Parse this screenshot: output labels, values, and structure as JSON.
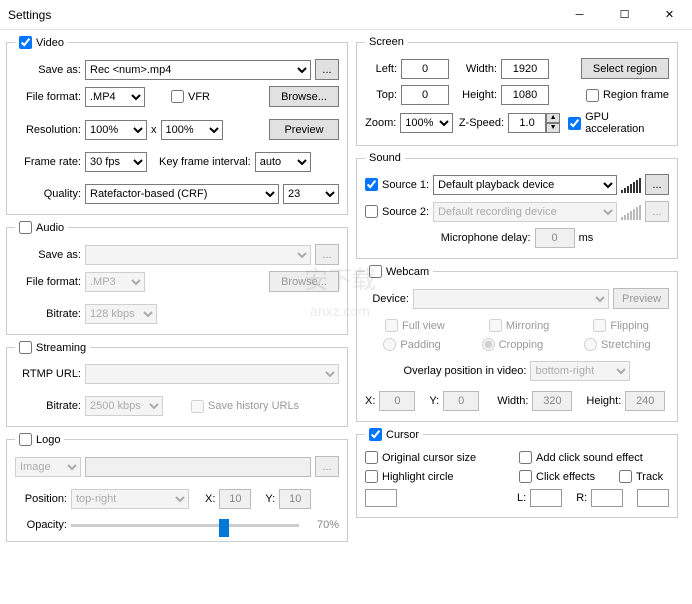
{
  "window": {
    "title": "Settings"
  },
  "video": {
    "legend": "Video",
    "save_as_lbl": "Save as:",
    "save_as": "Rec <num>.mp4",
    "file_format_lbl": "File format:",
    "file_format": ".MP4",
    "vfr_lbl": "VFR",
    "browse": "Browse...",
    "resolution_lbl": "Resolution:",
    "res_w": "100%",
    "res_h": "100%",
    "x": "x",
    "preview": "Preview",
    "frame_rate_lbl": "Frame rate:",
    "frame_rate": "30 fps",
    "kfi_lbl": "Key frame interval:",
    "kfi": "auto",
    "quality_lbl": "Quality:",
    "quality": "Ratefactor-based (CRF)",
    "crf": "23",
    "ellipsis": "..."
  },
  "audio": {
    "legend": "Audio",
    "save_as_lbl": "Save as:",
    "save_as": "",
    "file_format_lbl": "File format:",
    "file_format": ".MP3",
    "browse": "Browse...",
    "bitrate_lbl": "Bitrate:",
    "bitrate": "128 kbps",
    "ellipsis": "..."
  },
  "streaming": {
    "legend": "Streaming",
    "url_lbl": "RTMP URL:",
    "url": "",
    "bitrate_lbl": "Bitrate:",
    "bitrate": "2500 kbps",
    "save_hist": "Save history URLs"
  },
  "logo": {
    "legend": "Logo",
    "type": "Image",
    "position_lbl": "Position:",
    "position": "top-right",
    "x_lbl": "X:",
    "x": "10",
    "y_lbl": "Y:",
    "y": "10",
    "opacity_lbl": "Opacity:",
    "opacity_val": "70%",
    "ellipsis": "..."
  },
  "screen": {
    "legend": "Screen",
    "left_lbl": "Left:",
    "left": "0",
    "width_lbl": "Width:",
    "width": "1920",
    "select_region": "Select region",
    "top_lbl": "Top:",
    "top": "0",
    "height_lbl": "Height:",
    "height": "1080",
    "region_frame": "Region frame",
    "zoom_lbl": "Zoom:",
    "zoom": "100%",
    "zspeed_lbl": "Z-Speed:",
    "zspeed": "1.0",
    "gpu": "GPU acceleration"
  },
  "sound": {
    "legend": "Sound",
    "src1_lbl": "Source 1:",
    "src1": "Default playback device",
    "src2_lbl": "Source 2:",
    "src2": "Default recording device",
    "mic_delay_lbl": "Microphone delay:",
    "mic_delay": "0",
    "ms": "ms",
    "ellipsis": "..."
  },
  "webcam": {
    "legend": "Webcam",
    "device_lbl": "Device:",
    "preview": "Preview",
    "full_view": "Full view",
    "mirroring": "Mirroring",
    "flipping": "Flipping",
    "padding": "Padding",
    "cropping": "Cropping",
    "stretching": "Stretching",
    "overlay_lbl": "Overlay position in video:",
    "overlay": "bottom-right",
    "x_lbl": "X:",
    "x": "0",
    "y_lbl": "Y:",
    "y": "0",
    "width_lbl": "Width:",
    "width": "320",
    "height_lbl": "Height:",
    "height": "240"
  },
  "cursor": {
    "legend": "Cursor",
    "orig_size": "Original cursor size",
    "click_sound": "Add click sound effect",
    "highlight": "Highlight circle",
    "click_fx": "Click effects",
    "track": "Track",
    "l_lbl": "L:",
    "r_lbl": "R:"
  }
}
